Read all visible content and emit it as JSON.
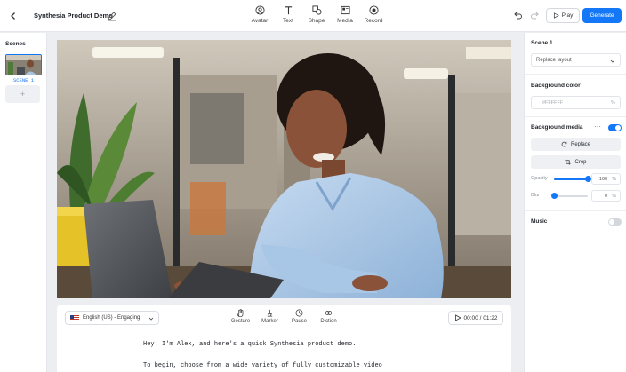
{
  "topbar": {
    "project_title": "Synthesia Product Demo",
    "tools": [
      {
        "label": "Avatar",
        "icon": "avatar-icon"
      },
      {
        "label": "Text",
        "icon": "text-icon"
      },
      {
        "label": "Shape",
        "icon": "shape-icon"
      },
      {
        "label": "Media",
        "icon": "media-icon"
      },
      {
        "label": "Record",
        "icon": "record-icon"
      }
    ],
    "play_label": "Play",
    "generate_label": "Generate"
  },
  "scenes": {
    "title": "Scenes",
    "items": [
      {
        "label": "SCENE 1"
      }
    ],
    "add_label": "+"
  },
  "script": {
    "language": "English (US) - Engaging",
    "tools": [
      {
        "label": "Gesture",
        "icon": "gesture-icon"
      },
      {
        "label": "Marker",
        "icon": "marker-icon"
      },
      {
        "label": "Pause",
        "icon": "pause-icon"
      },
      {
        "label": "Diction",
        "icon": "diction-icon"
      }
    ],
    "timer": "00:00 / 01:22",
    "lines": [
      "Hey! I'm Alex, and here's a quick Synthesia product demo.",
      "To begin, choose from a wide variety of fully customizable video"
    ]
  },
  "props": {
    "scene_title": "Scene 1",
    "layout_select": "Replace layout",
    "bg_color_label": "Background color",
    "bg_color_value": "#FFFFFF",
    "bg_color_unit": "%",
    "bg_media_label": "Background media",
    "bg_media_enabled": true,
    "replace_label": "Replace",
    "crop_label": "Crop",
    "opacity_label": "Opacity",
    "opacity_value": "100",
    "opacity_fraction": 1.0,
    "blur_label": "Blur",
    "blur_value": "0",
    "blur_fraction": 0.0,
    "percent_unit": "%",
    "music_label": "Music",
    "music_enabled": false
  },
  "colors": {
    "accent": "#1477f8",
    "panel_bg": "#ffffff",
    "app_bg": "#eceef1"
  }
}
